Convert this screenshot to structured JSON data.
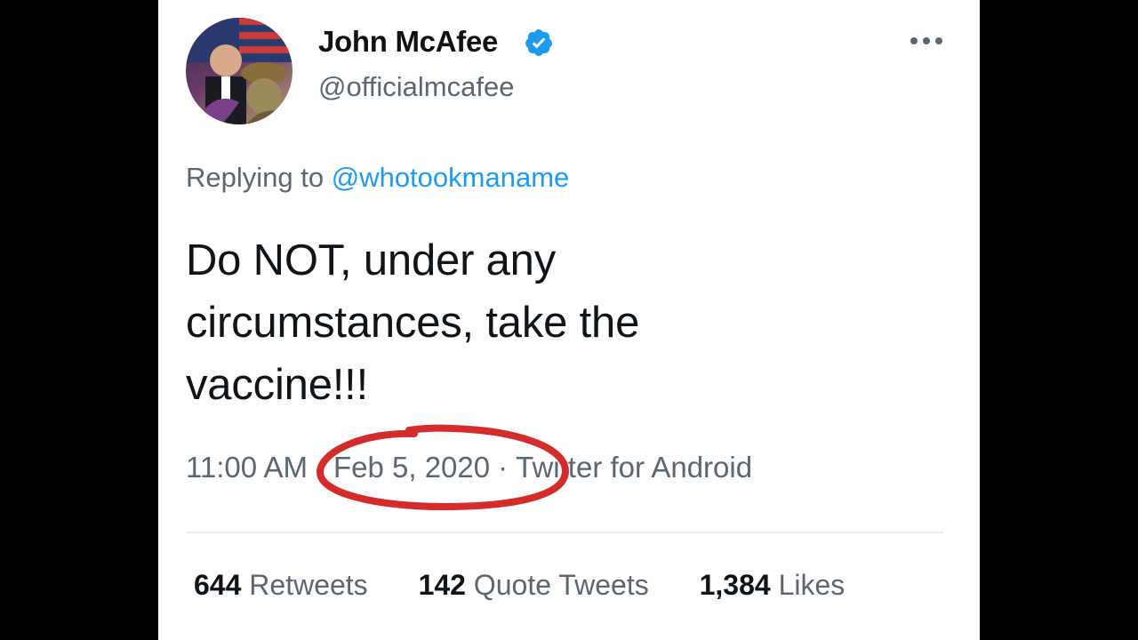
{
  "tweet": {
    "display_name": "John McAfee",
    "handle": "@officialmcafee",
    "verified": true,
    "reply_prefix": "Replying to",
    "reply_to": "@whotookmaname",
    "text": "Do NOT, under any circumstances, take the vaccine!!!",
    "time": "11:00 AM",
    "date": "Feb 5, 2020",
    "source": "Twitter for Android",
    "separator": "·"
  },
  "stats": [
    {
      "count": "644",
      "label": "Retweets"
    },
    {
      "count": "142",
      "label": "Quote Tweets"
    },
    {
      "count": "1,384",
      "label": "Likes"
    }
  ],
  "colors": {
    "accent": "#1d9bf0",
    "annotation": "#d62b2b",
    "text": "#0f1419",
    "muted": "#5b6670"
  },
  "icons": {
    "verified": "verified-badge-icon",
    "more": "more-dots-icon"
  }
}
